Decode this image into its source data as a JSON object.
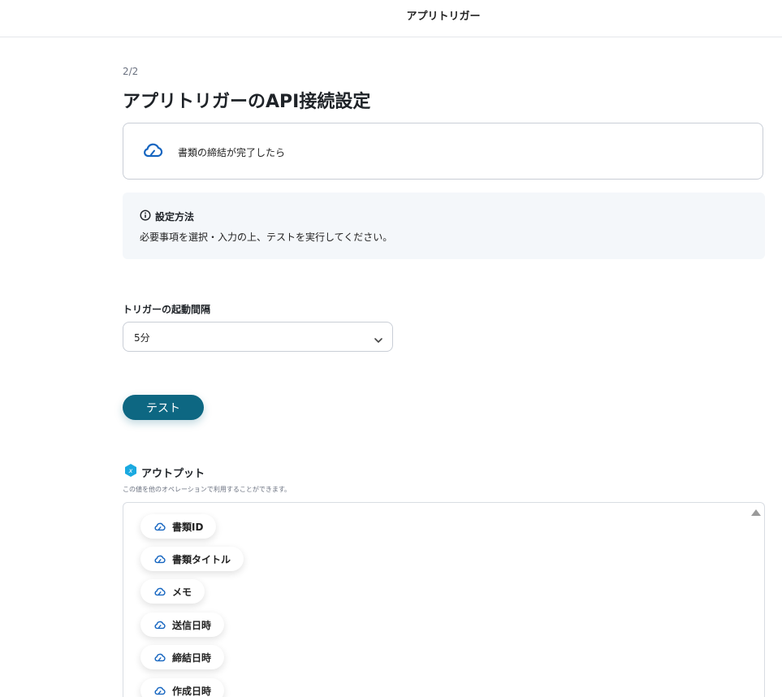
{
  "header": {
    "title": "アプリトリガー"
  },
  "step": "2/2",
  "page_title": "アプリトリガーのAPI接続設定",
  "event": {
    "label": "書類の締結が完了したら"
  },
  "info": {
    "title": "設定方法",
    "text": "必要事項を選択・入力の上、テストを実行してください。"
  },
  "interval": {
    "label": "トリガーの起動間隔",
    "value": "5分"
  },
  "test_button": "テスト",
  "output": {
    "title": "アウトプット",
    "description": "この値を他のオペレーションで利用することができます。",
    "items": [
      {
        "label": "書類ID"
      },
      {
        "label": "書類タイトル"
      },
      {
        "label": "メモ"
      },
      {
        "label": "送信日時"
      },
      {
        "label": "締結日時"
      },
      {
        "label": "作成日時"
      }
    ]
  },
  "colors": {
    "accent": "#0d6782",
    "cloud_icon": "#1565c0",
    "info_bg": "#f4f7fa"
  }
}
